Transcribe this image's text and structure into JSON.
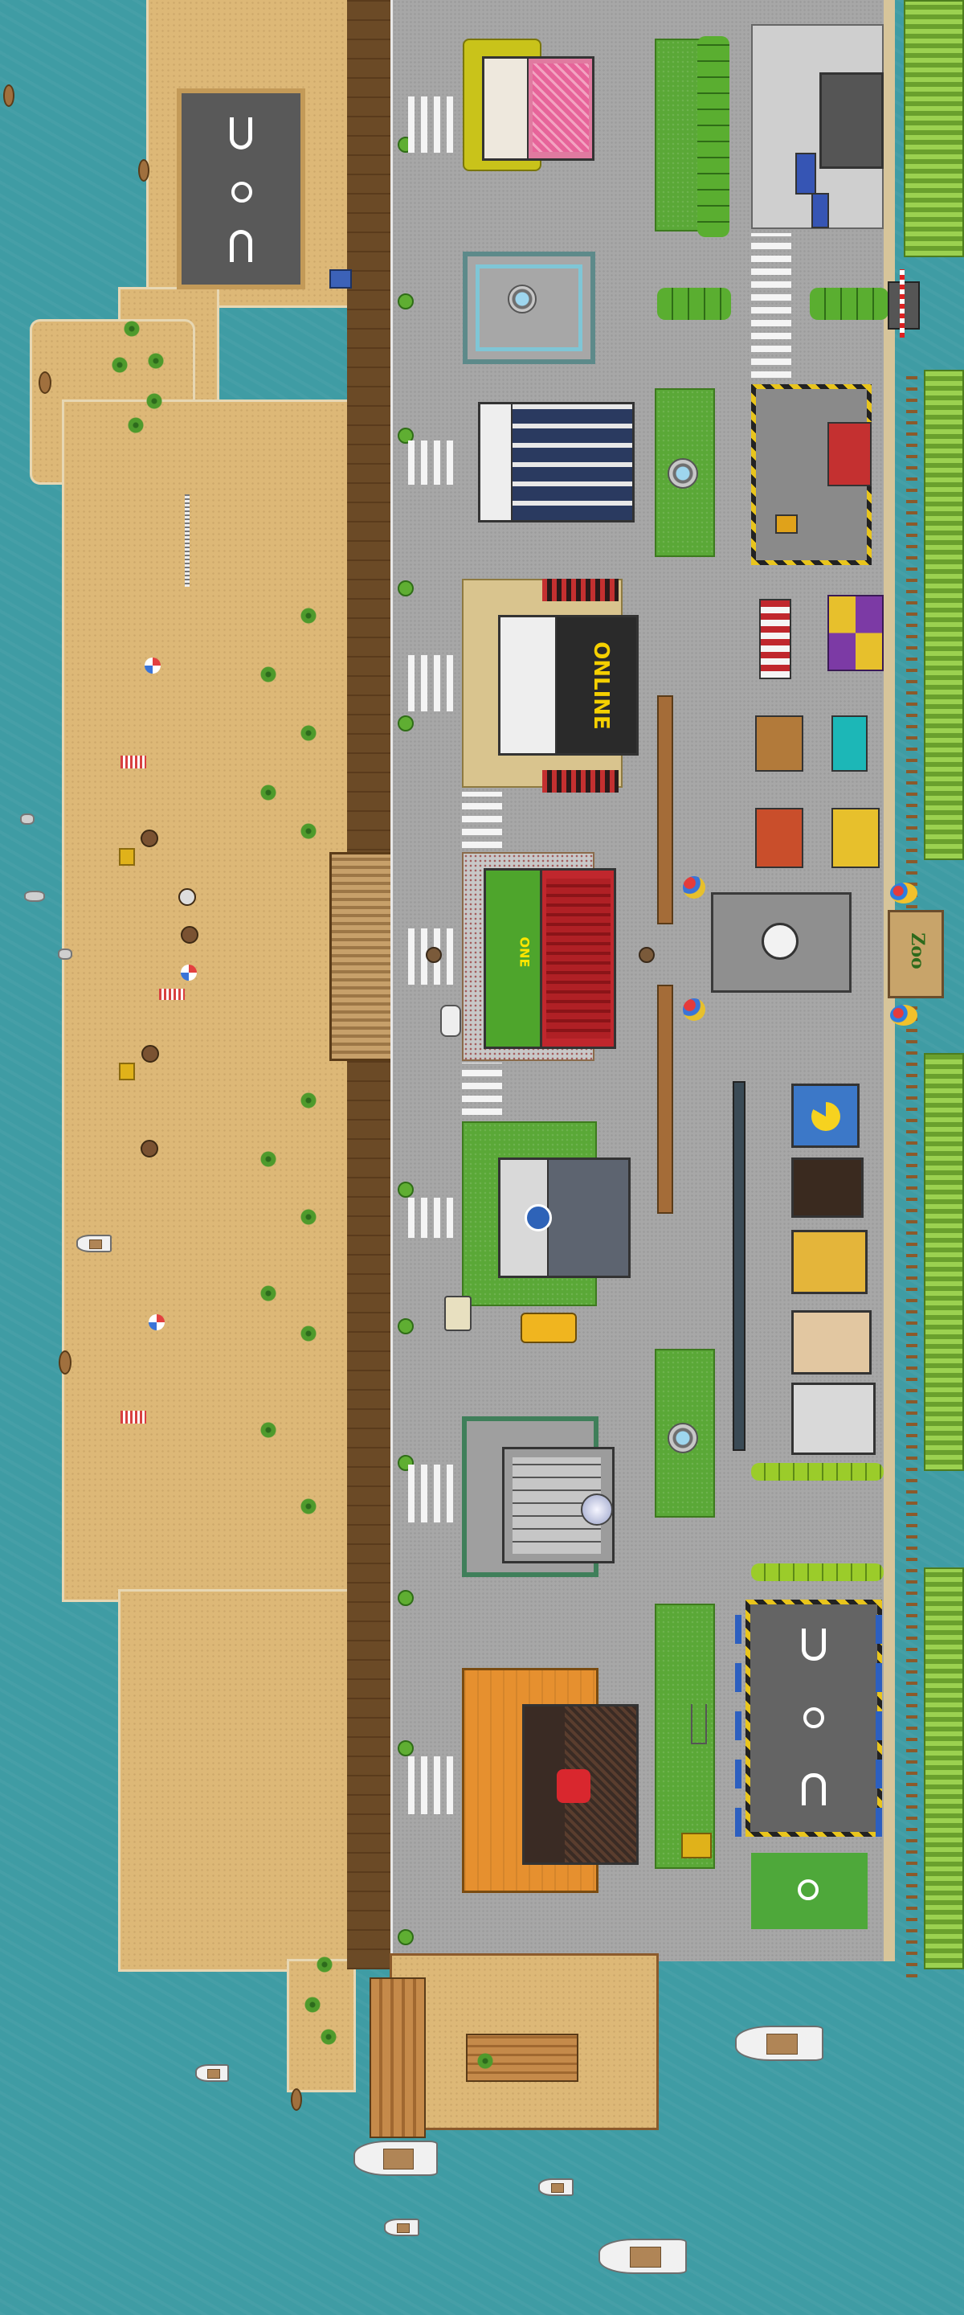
{
  "map": {
    "name": "",
    "palette": {
      "sea": "#3f9ca4",
      "sand": "#ddb877",
      "road": "#a7a7a7",
      "grass": "#5aa837",
      "hedge": "#7fb93c",
      "seawall": "#6b4a26"
    }
  },
  "signs": {
    "bar_sign": "ONLINE",
    "cafe_sign": "ONE",
    "zoo_sign": "Zoo"
  },
  "legend_icons": [
    "beach-icon",
    "palm-tree-icon",
    "beach-ball-icon",
    "beach-umbrella-icon",
    "towel-icon",
    "sun-lounger-icon",
    "boat-icon",
    "rowboat-icon",
    "helipad-icon",
    "fountain-icon",
    "clock-tower-icon",
    "parking-icon",
    "car-icon",
    "bus-icon"
  ]
}
